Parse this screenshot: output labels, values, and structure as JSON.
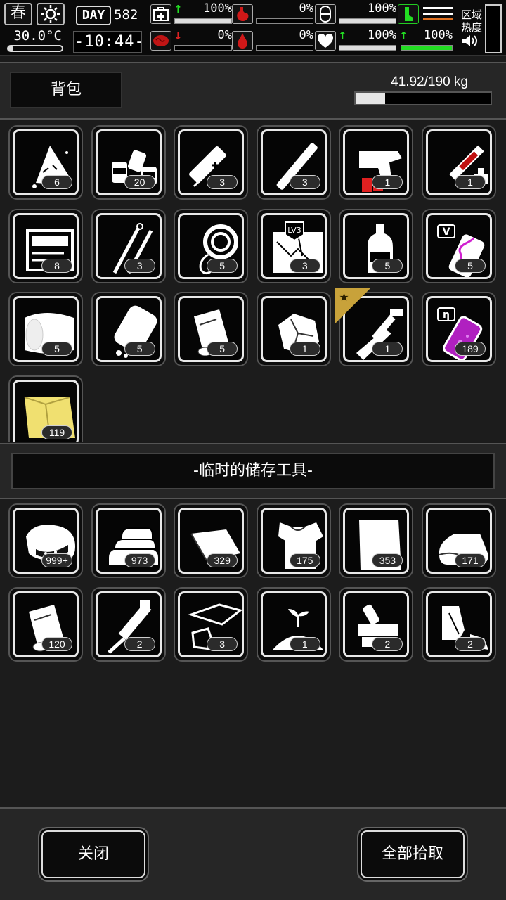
{
  "hud": {
    "season": "春",
    "temperature": "30.0°C",
    "day_label": "DAY",
    "day_number": "582",
    "clock": "-10:44-",
    "stats": [
      {
        "name": "health",
        "arrow": "↑",
        "arrow_color": "#22dd22",
        "value": "100%",
        "level": 1.0
      },
      {
        "name": "hunger",
        "arrow": "",
        "arrow_color": "#cc2222",
        "value": "0%",
        "level": 0.0
      },
      {
        "name": "medicine",
        "arrow": "",
        "arrow_color": "#ffffff",
        "value": "100%",
        "level": 1.0
      },
      {
        "name": "mood",
        "arrow": "↓",
        "arrow_color": "#dd2222",
        "value": "0%",
        "level": 0.0
      },
      {
        "name": "thirst",
        "arrow": "",
        "arrow_color": "#cc2222",
        "value": "0%",
        "level": 0.0
      },
      {
        "name": "heart",
        "arrow": "↑",
        "arrow_color": "#22dd22",
        "value": "100%",
        "level": 1.0
      },
      {
        "name": "stamina",
        "arrow": "↑",
        "arrow_color": "#22dd22",
        "value": "100%",
        "level": 1.0
      }
    ],
    "zone_label": "区域\n热度"
  },
  "backpack": {
    "title": "背包",
    "weight": "41.92/190 kg",
    "weight_fraction": 0.22,
    "items": [
      {
        "icon": "cloth-rag-icon",
        "count": "6"
      },
      {
        "icon": "pills-bottles-icon",
        "count": "20"
      },
      {
        "icon": "syringe-battery-icon",
        "count": "3"
      },
      {
        "icon": "cigarette-icon",
        "count": "3"
      },
      {
        "icon": "flare-gun-icon",
        "count": "1"
      },
      {
        "icon": "blood-syringe-icon",
        "count": "1"
      },
      {
        "icon": "toolbox-icon",
        "count": "8"
      },
      {
        "icon": "lockpick-icon",
        "count": "3"
      },
      {
        "icon": "rope-icon",
        "count": "5"
      },
      {
        "icon": "map-lv3-icon",
        "count": "3"
      },
      {
        "icon": "bottle-icon",
        "count": "5"
      },
      {
        "icon": "virus-vial-v-icon",
        "count": "5"
      },
      {
        "icon": "bandage-roll-icon",
        "count": "5"
      },
      {
        "icon": "pill-bottle-icon",
        "count": "5"
      },
      {
        "icon": "paper-roll-icon",
        "count": "5"
      },
      {
        "icon": "rock-icon",
        "count": "1"
      },
      {
        "icon": "caliper-knife-icon",
        "count": "1",
        "ranked": true
      },
      {
        "icon": "purple-vial-icon",
        "count": "189"
      },
      {
        "icon": "yellow-cloth-icon",
        "count": "119"
      }
    ]
  },
  "storage": {
    "title": "-临时的储存工具-",
    "items": [
      {
        "icon": "meat-chunk-icon",
        "count": "999+"
      },
      {
        "icon": "folded-cloth-icon",
        "count": "973"
      },
      {
        "icon": "leather-sheet-icon",
        "count": "329"
      },
      {
        "icon": "torn-shirt-icon",
        "count": "175"
      },
      {
        "icon": "paper-sheet-icon",
        "count": "353"
      },
      {
        "icon": "fabric-bolt-icon",
        "count": "171"
      },
      {
        "icon": "paper-roll-icon",
        "count": "120"
      },
      {
        "icon": "rasp-tool-icon",
        "count": "2"
      },
      {
        "icon": "glass-shards-icon",
        "count": "3"
      },
      {
        "icon": "soil-sprout-icon",
        "count": "1"
      },
      {
        "icon": "gun-parts-icon",
        "count": "2"
      },
      {
        "icon": "scrap-parts-icon",
        "count": "2"
      }
    ]
  },
  "footer": {
    "close_label": "关闭",
    "take_all_label": "全部拾取"
  }
}
